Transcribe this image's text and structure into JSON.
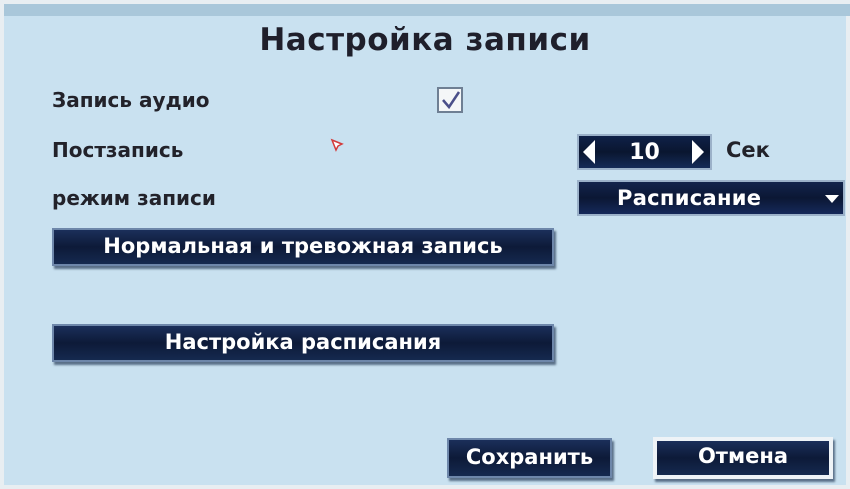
{
  "dialog": {
    "title": "Настройка записи"
  },
  "fields": {
    "audio_label": "Запись аудио",
    "audio_checked": true,
    "postrecord_label": "Постзапись",
    "postrecord_value": "10",
    "postrecord_unit": "Сек",
    "mode_label": "режим записи",
    "mode_value": "Расписание"
  },
  "buttons": {
    "normal_alarm": "Нормальная и тревожная запись",
    "schedule_setup": "Настройка расписания",
    "save": "Сохранить",
    "cancel": "Отмена"
  },
  "colors": {
    "background": "#c9e1f0",
    "button_dark": "#0d1a38"
  }
}
